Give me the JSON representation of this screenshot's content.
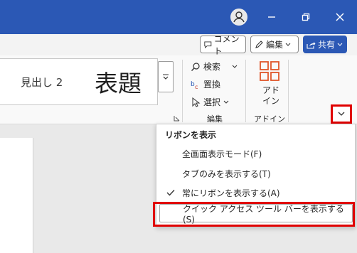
{
  "window": {
    "controls": {
      "user": "user-icon",
      "minimize": "−",
      "restore": "⧉",
      "close": "✕"
    }
  },
  "toolbar": {
    "comment_label": "コメント",
    "edit_label": "編集",
    "share_label": "共有"
  },
  "ribbon": {
    "styles": [
      "見出し 2",
      "表題"
    ],
    "editing": {
      "find": "検索",
      "replace": "置換",
      "select": "選択",
      "group_label": "編集"
    },
    "addins": {
      "button_label_line1": "アド",
      "button_label_line2": "イン",
      "group_label": "アドイン"
    }
  },
  "ribbon_menu": {
    "header": "リボンを表示",
    "items": [
      {
        "label": "全画面表示モード(F)",
        "checked": false
      },
      {
        "label": "タブのみを表示する(T)",
        "checked": false
      },
      {
        "label": "常にリボンを表示する(A)",
        "checked": true
      },
      {
        "label": "クイック アクセス ツール バーを表示する (S)",
        "checked": false
      }
    ]
  },
  "colors": {
    "titlebar": "#2b58b5",
    "highlight": "#e00000",
    "addins_icon": "#e0562a"
  }
}
